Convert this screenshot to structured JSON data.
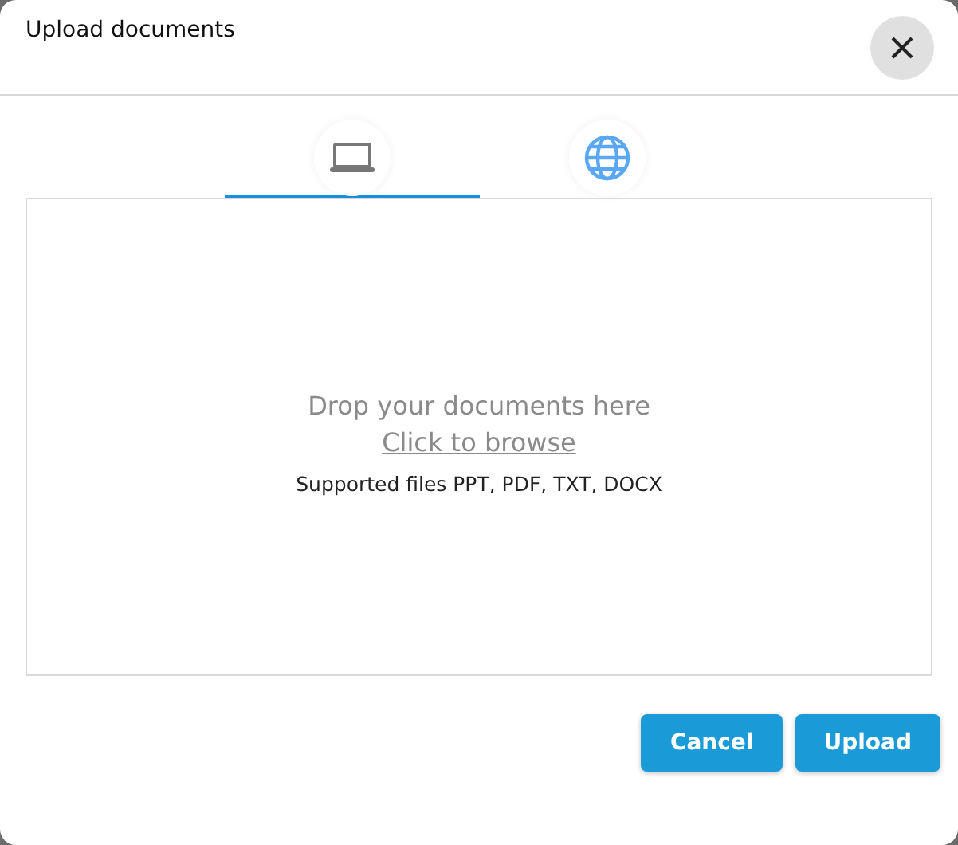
{
  "dialog": {
    "title": "Upload documents"
  },
  "tabs": [
    {
      "kind": "laptop",
      "selected": true
    },
    {
      "kind": "globe",
      "selected": false
    }
  ],
  "dropzone": {
    "prompt": "Drop your documents here",
    "link": "Click to browse",
    "hint": "Supported files PPT, PDF, TXT, DOCX"
  },
  "buttons": [
    "Cancel",
    "Upload"
  ]
}
